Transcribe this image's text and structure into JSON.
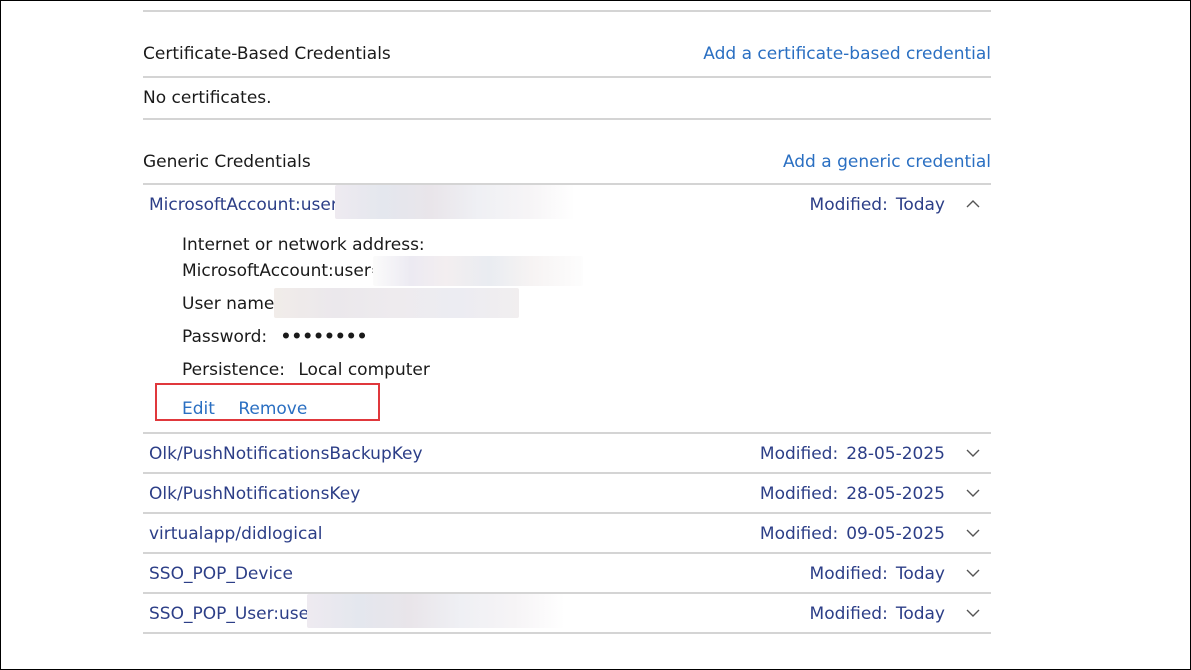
{
  "certificate_section": {
    "title": "Certificate-Based Credentials",
    "add_link": "Add a certificate-based credential",
    "empty_text": "No certificates."
  },
  "generic_section": {
    "title": "Generic Credentials",
    "add_link": "Add a generic credential"
  },
  "expanded_item": {
    "name": "MicrosoftAccount:user=",
    "modified_label": "Modified:",
    "modified_value": "Today",
    "address_label": "Internet or network address:",
    "address_value": "MicrosoftAccount:user=",
    "username_label": "User name:",
    "password_label": "Password:",
    "password_value": "••••••••",
    "persistence_label": "Persistence:",
    "persistence_value": "Local computer",
    "edit_label": "Edit",
    "remove_label": "Remove"
  },
  "items": [
    {
      "name": "Olk/PushNotificationsBackupKey",
      "modified_label": "Modified:",
      "modified_value": "28-05-2025"
    },
    {
      "name": "Olk/PushNotificationsKey",
      "modified_label": "Modified:",
      "modified_value": "28-05-2025"
    },
    {
      "name": "virtualapp/didlogical",
      "modified_label": "Modified:",
      "modified_value": "09-05-2025"
    },
    {
      "name": "SSO_POP_Device",
      "modified_label": "Modified:",
      "modified_value": "Today"
    },
    {
      "name": "SSO_POP_User:user",
      "modified_label": "Modified:",
      "modified_value": "Today"
    }
  ],
  "colors": {
    "link": "#2a6fc2",
    "item_text": "#2c3e87",
    "divider": "#d4d4d4",
    "highlight_box": "#e0383c"
  }
}
